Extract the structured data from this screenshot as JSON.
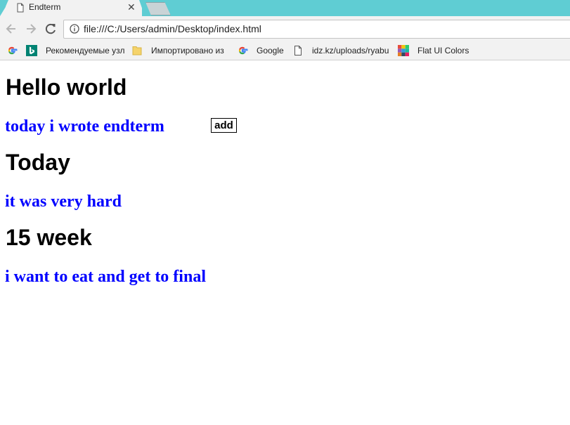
{
  "browser": {
    "tab": {
      "title": "Endterm",
      "close_glyph": "✕"
    },
    "address": {
      "url": "file:///C:/Users/admin/Desktop/index.html"
    },
    "bookmarks": [
      {
        "icon": "google-icon",
        "label": ""
      },
      {
        "icon": "bing-icon",
        "label": "Рекомендуемые узл"
      },
      {
        "icon": "folder-icon",
        "label": "Импортировано из"
      },
      {
        "icon": "google-icon",
        "label": "Google"
      },
      {
        "icon": "page-icon",
        "label": "idz.kz/uploads/ryabu"
      },
      {
        "icon": "flat-ui-colors-icon",
        "label": "Flat UI Colors"
      }
    ],
    "colors": {
      "tab_strip": "#5fcdd3",
      "chrome": "#f2f2f2"
    }
  },
  "page": {
    "heading_1": "Hello world",
    "text_1": "today i wrote endterm",
    "add_button": "add",
    "heading_2": "Today",
    "text_2": "it was very hard",
    "heading_3": "15 week",
    "text_3": "i want to eat and get to final",
    "colors": {
      "text_blue": "#0000ff"
    }
  }
}
